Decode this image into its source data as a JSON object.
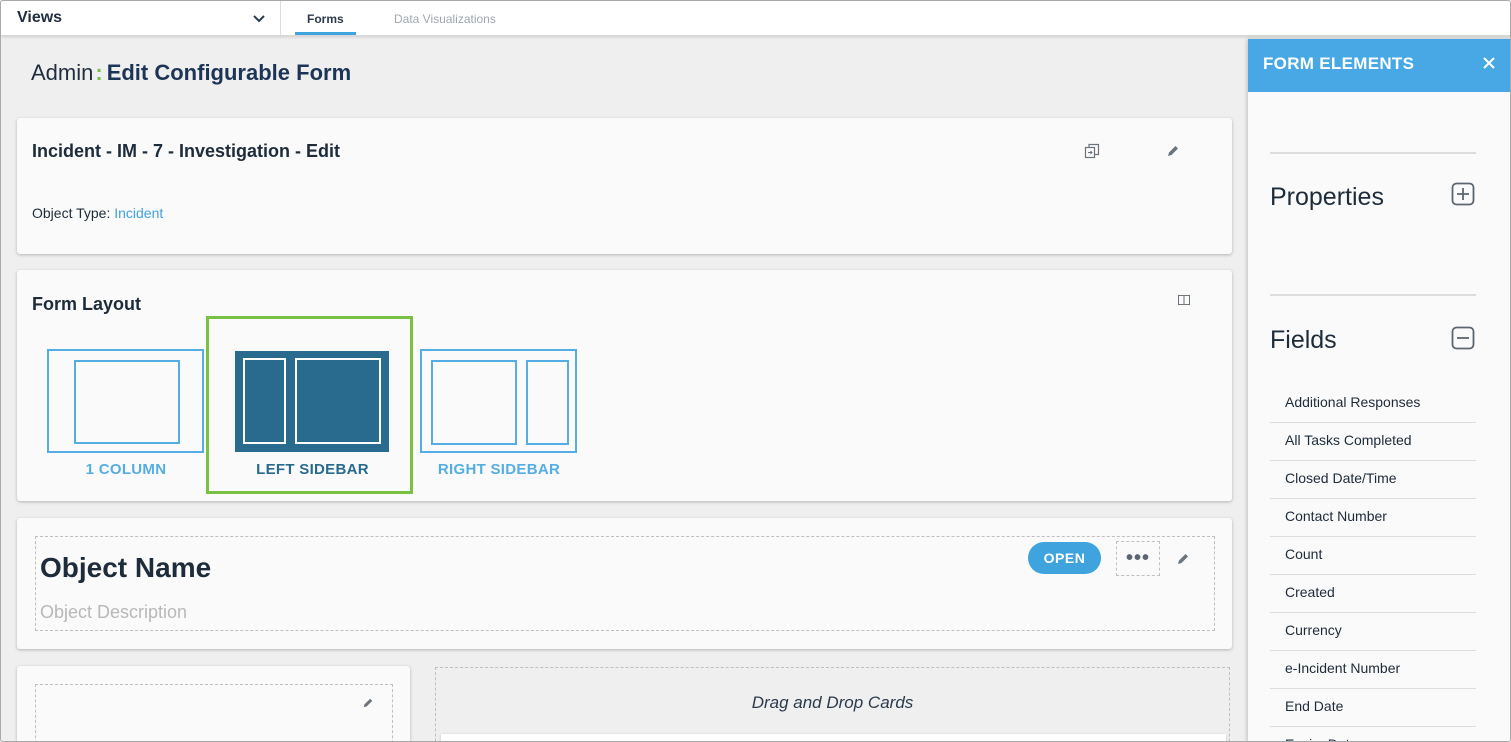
{
  "topbar": {
    "views_label": "Views",
    "tabs": [
      {
        "label": "Forms",
        "active": true
      },
      {
        "label": "Data Visualizations",
        "active": false
      }
    ]
  },
  "header": {
    "admin": "Admin",
    "separator": ":",
    "title": "Edit Configurable Form"
  },
  "form_card": {
    "title": "Incident - IM - 7 - Investigation - Edit",
    "object_type_label": "Object Type:",
    "object_type_value": "Incident"
  },
  "layout_card": {
    "title": "Form Layout",
    "options": [
      {
        "label": "1 COLUMN",
        "selected": false
      },
      {
        "label": "LEFT SIDEBAR",
        "selected": true
      },
      {
        "label": "RIGHT SIDEBAR",
        "selected": false
      }
    ]
  },
  "object_card": {
    "name": "Object Name",
    "description": "Object Description",
    "status_button": "OPEN",
    "more_label": "•••"
  },
  "drop_zone": {
    "label": "Drag and Drop Cards"
  },
  "panel": {
    "title": "FORM ELEMENTS",
    "properties_title": "Properties",
    "fields_title": "Fields",
    "fields": [
      "Additional Responses",
      "All Tasks Completed",
      "Closed Date/Time",
      "Contact Number",
      "Count",
      "Created",
      "Currency",
      "e-Incident Number",
      "End Date",
      "Expiry Date"
    ]
  },
  "colors": {
    "accent_blue": "#3fa3dd",
    "panel_header": "#47a8e5",
    "selected_layout": "#296b8e",
    "highlight_green": "#7ac043"
  }
}
